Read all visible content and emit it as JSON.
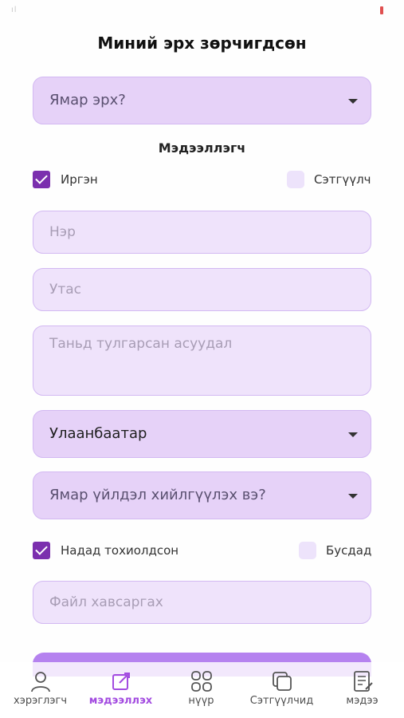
{
  "status_bar": {
    "left_text": "ıl",
    "battery_color": "#e05050"
  },
  "page": {
    "title": "Миний эрх зөрчигдсөн"
  },
  "right_select": {
    "placeholder": "Ямар эрх?"
  },
  "reporter": {
    "label": "Мэдээллэгч",
    "options": [
      {
        "label": "Иргэн",
        "checked": true
      },
      {
        "label": "Сэтгүүлч",
        "checked": false
      }
    ]
  },
  "fields": {
    "name_placeholder": "Нэр",
    "phone_placeholder": "Утас",
    "problem_placeholder": "Таньд тулгарсан асуудал",
    "file_placeholder": "Файл хавсаргах"
  },
  "city_select": {
    "value": "Улаанбаатар"
  },
  "action_select": {
    "placeholder": "Ямар үйлдэл хийлгүүлэх вэ?"
  },
  "affected": {
    "options": [
      {
        "label": "Надад тохиолдсон",
        "checked": true
      },
      {
        "label": "Бусдад",
        "checked": false
      }
    ]
  },
  "colors": {
    "accent": "#a34ce0",
    "checkbox": "#7b2fae",
    "field_bg": "#efe3fb",
    "select_bg": "#e6d2f8",
    "submit": "#b582ef"
  },
  "bottom_nav": {
    "items": [
      {
        "label": "хэрэглэгч",
        "icon": "user-icon",
        "active": false
      },
      {
        "label": "мэдээллэх",
        "icon": "edit-icon",
        "active": true
      },
      {
        "label": "нүүр",
        "icon": "grid-icon",
        "active": false
      },
      {
        "label": "Сэтгүүлчид",
        "icon": "copy-icon",
        "active": false
      },
      {
        "label": "мэдээ",
        "icon": "news-icon",
        "active": false
      }
    ]
  }
}
